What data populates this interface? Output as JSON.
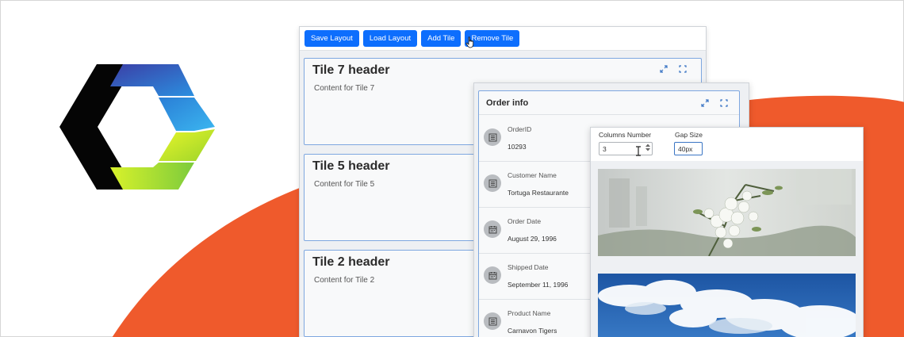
{
  "toolbar": {
    "buttons": [
      "Save Layout",
      "Load Layout",
      "Add Tile",
      "Remove Tile"
    ]
  },
  "tiles": [
    {
      "title": "Tile 7 header",
      "content": "Content for Tile 7"
    },
    {
      "title": "Tile 5 header",
      "content": "Content for Tile 5"
    },
    {
      "title": "Tile 2 header",
      "content": "Content for Tile 2"
    }
  ],
  "order_info": {
    "title": "Order info",
    "rows": [
      {
        "label": "OrderID",
        "value": "10293",
        "icon": "list-icon"
      },
      {
        "label": "Customer Name",
        "value": "Tortuga Restaurante",
        "icon": "list-icon"
      },
      {
        "label": "Order Date",
        "value": "August 29, 1996",
        "icon": "calendar-icon"
      },
      {
        "label": "Shipped Date",
        "value": "September 11, 1996",
        "icon": "calendar-icon"
      },
      {
        "label": "Product Name",
        "value": "Carnavon Tigers",
        "icon": "list-icon"
      }
    ]
  },
  "image_grid": {
    "columns_label": "Columns Number",
    "columns_value": "3",
    "gap_label": "Gap Size",
    "gap_value": "40px",
    "images": [
      "blossom-photo",
      "sky-clouds-photo"
    ]
  },
  "colors": {
    "accent_blue": "#0d6efd",
    "orange": "#ef5a2c",
    "tile_border": "#7ea7e0"
  },
  "icons": [
    "maximize-icon",
    "fullscreen-icon",
    "hand-cursor-icon",
    "text-cursor-icon"
  ]
}
